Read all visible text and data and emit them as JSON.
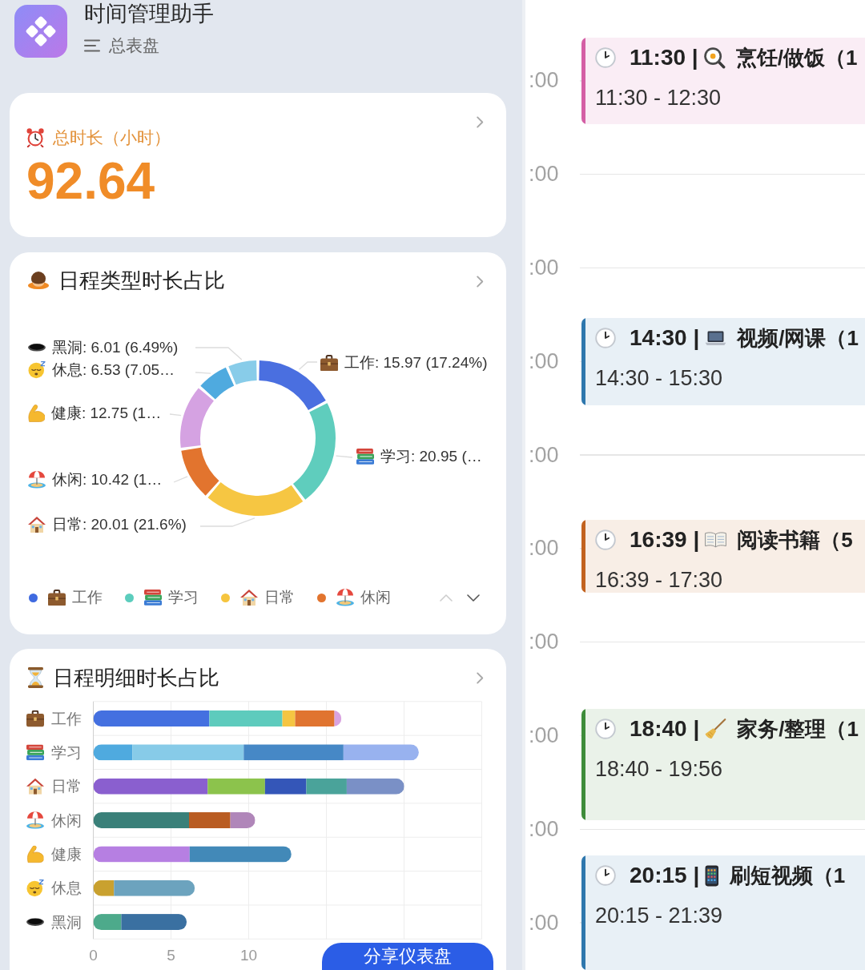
{
  "app": {
    "title": "时间管理助手",
    "subtitle": "总表盘"
  },
  "total_card": {
    "label": "总时长（小时）",
    "value": "92.64"
  },
  "type_card": {
    "title": "日程类型时长占比",
    "chart_data": {
      "type": "donut",
      "values": [
        15.97,
        20.95,
        20.01,
        10.42,
        12.75,
        6.53,
        6.01
      ],
      "colors": [
        "#4a6fe0",
        "#5fcdbd",
        "#f6c642",
        "#e2742e",
        "#d5a2e2",
        "#4faadf",
        "#88cce9"
      ],
      "value_labels": [
        "工作: 15.97 (17.24%)",
        "学习: 20.95 (…",
        "日常: 20.01 (21.6%)",
        "休闲: 10.42 (1…",
        "健康: 12.75 (1…",
        "休息: 6.53 (7.05…",
        "黑洞: 6.01 (6.49%)"
      ]
    },
    "legend": {
      "items": [
        {
          "label": "工作",
          "color": "#3f6ae0"
        },
        {
          "label": "学习",
          "color": "#5ccdbd"
        },
        {
          "label": "日常",
          "color": "#f6c53e"
        },
        {
          "label": "休闲",
          "color": "#e2742e"
        }
      ],
      "previous_disabled": true,
      "next_disabled": false
    }
  },
  "detail_card": {
    "title": "日程明细时长占比",
    "chart_data": {
      "type": "bar",
      "orientation": "horizontal",
      "stacked": true,
      "categories": [
        "工作",
        "学习",
        "日常",
        "休闲",
        "健康",
        "休息",
        "黑洞"
      ],
      "xlim": [
        0,
        25
      ],
      "xticks": [
        0,
        5,
        10
      ],
      "series": [
        {
          "color": "#4470e0",
          "values": [
            7.47,
            null,
            null,
            null,
            null,
            null,
            null
          ]
        },
        {
          "color": "#5ecbbd",
          "values": [
            4.7,
            null,
            null,
            null,
            null,
            null,
            null
          ]
        },
        {
          "color": "#f5c542",
          "values": [
            0.82,
            null,
            null,
            null,
            null,
            null,
            null
          ]
        },
        {
          "color": "#e07430",
          "values": [
            2.53,
            null,
            null,
            null,
            null,
            null,
            null
          ]
        },
        {
          "color": "#d9a3e0",
          "values": [
            0.45,
            null,
            null,
            null,
            null,
            null,
            null
          ]
        },
        {
          "color": "#4faadf",
          "values": [
            null,
            2.51,
            null,
            null,
            null,
            null,
            null
          ]
        },
        {
          "color": "#87cbe8",
          "values": [
            null,
            7.17,
            null,
            null,
            null,
            null,
            null
          ]
        },
        {
          "color": "#4688c6",
          "values": [
            null,
            6.42,
            null,
            null,
            null,
            null,
            null
          ]
        },
        {
          "color": "#98b2ef",
          "values": [
            null,
            4.85,
            null,
            null,
            null,
            null,
            null
          ]
        },
        {
          "color": "#8a5fcf",
          "values": [
            null,
            null,
            7.36,
            null,
            null,
            null,
            null
          ]
        },
        {
          "color": "#8cc34c",
          "values": [
            null,
            null,
            3.69,
            null,
            null,
            null,
            null
          ]
        },
        {
          "color": "#3456b8",
          "values": [
            null,
            null,
            2.66,
            null,
            null,
            null,
            null
          ]
        },
        {
          "color": "#4aa39a",
          "values": [
            null,
            null,
            2.6,
            null,
            null,
            null,
            null
          ]
        },
        {
          "color": "#7a90c6",
          "values": [
            null,
            null,
            3.7,
            null,
            null,
            null,
            null
          ]
        },
        {
          "color": "#3a8079",
          "values": [
            null,
            null,
            null,
            6.16,
            null,
            null,
            null
          ]
        },
        {
          "color": "#b95c22",
          "values": [
            null,
            null,
            null,
            2.66,
            null,
            null,
            null
          ]
        },
        {
          "color": "#b086b9",
          "values": [
            null,
            null,
            null,
            1.6,
            null,
            null,
            null
          ]
        },
        {
          "color": "#b67fe2",
          "values": [
            null,
            null,
            null,
            null,
            6.2,
            null,
            null
          ]
        },
        {
          "color": "#4289b8",
          "values": [
            null,
            null,
            null,
            null,
            6.55,
            null,
            null
          ]
        },
        {
          "color": "#c9a12f",
          "values": [
            null,
            null,
            null,
            null,
            null,
            1.33,
            null
          ]
        },
        {
          "color": "#6ca3be",
          "values": [
            null,
            null,
            null,
            null,
            null,
            5.2,
            null
          ]
        },
        {
          "color": "#4daa8b",
          "values": [
            null,
            null,
            null,
            null,
            null,
            null,
            1.8
          ]
        },
        {
          "color": "#3a70a1",
          "values": [
            null,
            null,
            null,
            null,
            null,
            null,
            4.21
          ]
        }
      ]
    }
  },
  "share_button": {
    "label": "分享仪表盘"
  },
  "calendar": {
    "hour_labels": [
      ":00",
      ":00",
      ":00",
      ":00",
      ":00",
      ":00",
      ":00",
      ":00",
      ":00",
      ":00"
    ],
    "events": [
      {
        "start": "11:30 |",
        "title": "烹饪/做饭（1",
        "range": "11:30 - 12:30",
        "color": "#d45fa5"
      },
      {
        "start": "14:30 |",
        "title": "视频/网课（1",
        "range": "14:30 - 15:30",
        "color": "#2e77ad"
      },
      {
        "start": "16:39 |",
        "title": "阅读书籍（5",
        "range": "16:39 - 17:30",
        "color": "#c2621f"
      },
      {
        "start": "18:40 |",
        "title": "家务/整理（1",
        "range": "18:40 - 19:56",
        "color": "#3e8c3a"
      },
      {
        "start": "20:15 |",
        "title": "刷短视频（1",
        "range": "20:15 - 21:39",
        "color": "#2e77ad"
      }
    ]
  }
}
